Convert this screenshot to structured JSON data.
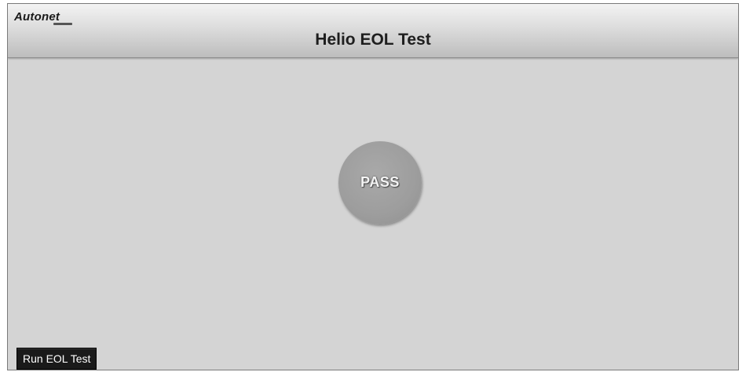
{
  "header": {
    "logo_text": "Autonet",
    "title": "Helio EOL Test"
  },
  "main": {
    "status": "PASS"
  },
  "footer": {
    "run_button_label": "Run EOL Test"
  }
}
